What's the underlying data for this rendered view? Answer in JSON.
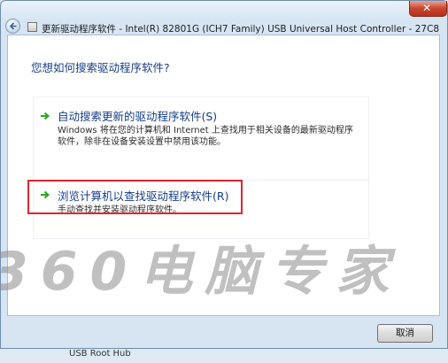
{
  "window": {
    "title": "更新驱动程序软件 - Intel(R) 82801G (ICH7 Family) USB Universal Host Controller - 27C8",
    "close_label": "✕"
  },
  "prompt": {
    "heading": "您想如何搜索驱动程序软件?"
  },
  "options": [
    {
      "title": "自动搜索更新的驱动程序软件(S)",
      "description": "Windows 将在您的计算机和 Internet 上查找用于相关设备的最新驱动程序软件，除非在设备安装设置中禁用该功能。"
    },
    {
      "title": "浏览计算机以查找驱动程序软件(R)",
      "description": "手动查找并安装驱动程序软件。"
    }
  ],
  "footer": {
    "cancel_label": "取消"
  },
  "watermark": {
    "text": "360电脑专家"
  },
  "background": {
    "list_item": "USB Root Hub"
  },
  "colors": {
    "accent_link": "#153d8a",
    "highlight_box": "#e0262b",
    "arrow_green": "#2aa81f"
  }
}
